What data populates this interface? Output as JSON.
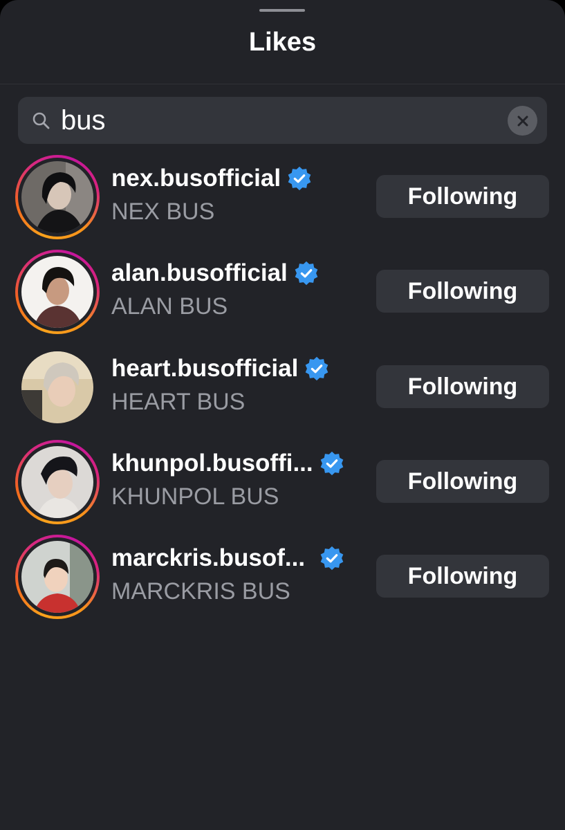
{
  "sheet": {
    "title": "Likes"
  },
  "search": {
    "value": "bus",
    "icon": "search-icon",
    "clear_icon": "close-icon"
  },
  "colors": {
    "background": "#222328",
    "surface": "#33353b",
    "text_primary": "#ffffff",
    "text_secondary": "#9a9ca3",
    "verified_badge": "#3897f0",
    "story_ring": [
      "#f9a21c",
      "#d82a7e",
      "#c4159d"
    ]
  },
  "users": [
    {
      "username": "nex.busofficial",
      "full_name": "NEX BUS",
      "verified": true,
      "story_ring": true,
      "button_label": "Following"
    },
    {
      "username": "alan.busofficial",
      "full_name": "ALAN BUS",
      "verified": true,
      "story_ring": true,
      "button_label": "Following"
    },
    {
      "username": "heart.busofficial",
      "full_name": "HEART BUS",
      "verified": true,
      "story_ring": false,
      "button_label": "Following"
    },
    {
      "username": "khunpol.busoffi...",
      "full_name": "KHUNPOL BUS",
      "verified": true,
      "story_ring": true,
      "button_label": "Following"
    },
    {
      "username": "marckris.busof...",
      "full_name": "MARCKRIS BUS",
      "verified": true,
      "story_ring": true,
      "button_label": "Following"
    }
  ]
}
